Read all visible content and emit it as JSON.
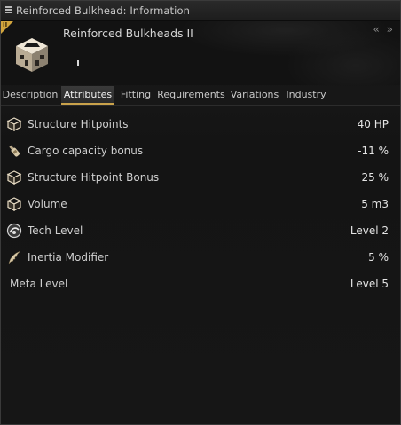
{
  "window": {
    "title": "Reinforced Bulkhead: Information",
    "collapse_icons": "« »"
  },
  "header": {
    "item_name": "Reinforced Bulkheads II",
    "tech_badge": "II",
    "item_icon": "module-crate-icon",
    "badge_color": "#d2a53d"
  },
  "tabs": [
    {
      "label": "Description",
      "active": false
    },
    {
      "label": "Attributes",
      "active": true
    },
    {
      "label": "Fitting",
      "active": false
    },
    {
      "label": "Requirements",
      "active": false
    },
    {
      "label": "Variations",
      "active": false
    },
    {
      "label": "Industry",
      "active": false
    }
  ],
  "attributes": [
    {
      "icon": "cube-icon",
      "label": "Structure Hitpoints",
      "value": "40 HP"
    },
    {
      "icon": "cargo-bottle-icon",
      "label": "Cargo capacity bonus",
      "value": "-11 %"
    },
    {
      "icon": "cube-icon",
      "label": "Structure Hitpoint Bonus",
      "value": "25 %"
    },
    {
      "icon": "cube-icon",
      "label": "Volume",
      "value": "5 m3"
    },
    {
      "icon": "tech-level-icon",
      "label": "Tech Level",
      "value": "Level 2"
    },
    {
      "icon": "wing-icon",
      "label": "Inertia Modifier",
      "value": "5 %"
    },
    {
      "icon": "",
      "label": "Meta Level",
      "value": "Level 5"
    }
  ],
  "accent_color": "#c9a24b"
}
